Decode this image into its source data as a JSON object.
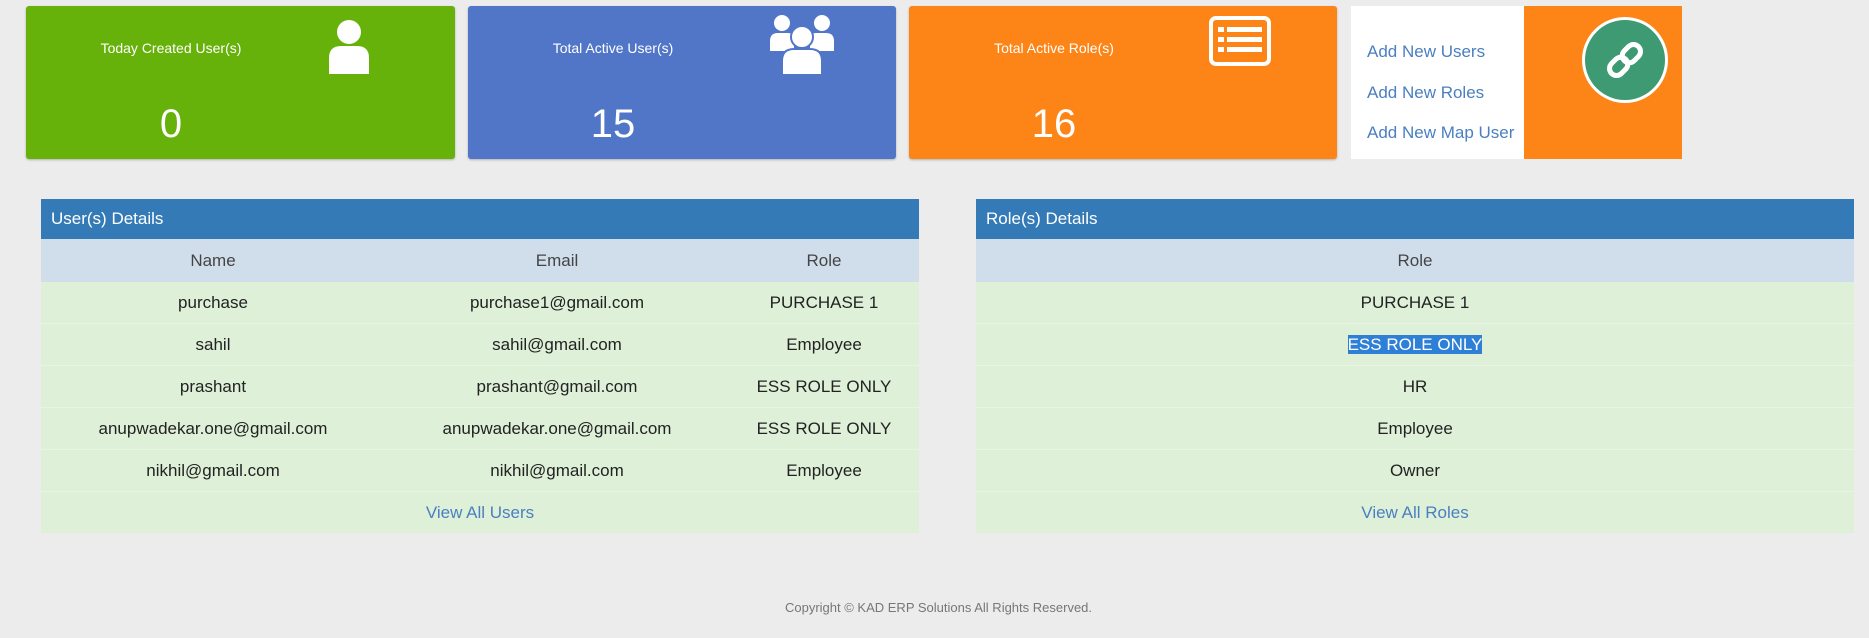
{
  "cards": {
    "today": {
      "label": "Today Created User(s)",
      "value": "0",
      "icon": "user-icon",
      "color": "#66b10a"
    },
    "active_users": {
      "label": "Total Active User(s)",
      "value": "15",
      "icon": "users-group-icon",
      "color": "#5176c8"
    },
    "active_roles": {
      "label": "Total Active Role(s)",
      "value": "16",
      "icon": "list-icon",
      "color": "#fd8517"
    }
  },
  "quick_links": {
    "add_users": "Add New Users",
    "add_roles": "Add New Roles",
    "add_map_user": "Add New Map User",
    "icon": "link-icon"
  },
  "users_panel": {
    "title": "User(s) Details",
    "headers": {
      "name": "Name",
      "email": "Email",
      "role": "Role"
    },
    "rows": [
      {
        "name": "purchase",
        "email": "purchase1@gmail.com",
        "role": "PURCHASE 1"
      },
      {
        "name": "sahil",
        "email": "sahil@gmail.com",
        "role": "Employee"
      },
      {
        "name": "prashant",
        "email": "prashant@gmail.com",
        "role": "ESS ROLE ONLY"
      },
      {
        "name": "anupwadekar.one@gmail.com",
        "email": "anupwadekar.one@gmail.com",
        "role": "ESS ROLE ONLY"
      },
      {
        "name": "nikhil@gmail.com",
        "email": "nikhil@gmail.com",
        "role": "Employee"
      }
    ],
    "view_all": "View All Users"
  },
  "roles_panel": {
    "title": "Role(s) Details",
    "header": "Role",
    "rows": [
      "PURCHASE 1",
      "ESS ROLE ONLY",
      "HR",
      "Employee",
      "Owner"
    ],
    "view_all": "View All Roles"
  },
  "footer": {
    "copyright": "Copyright © KAD ERP Solutions All Rights Reserved."
  }
}
